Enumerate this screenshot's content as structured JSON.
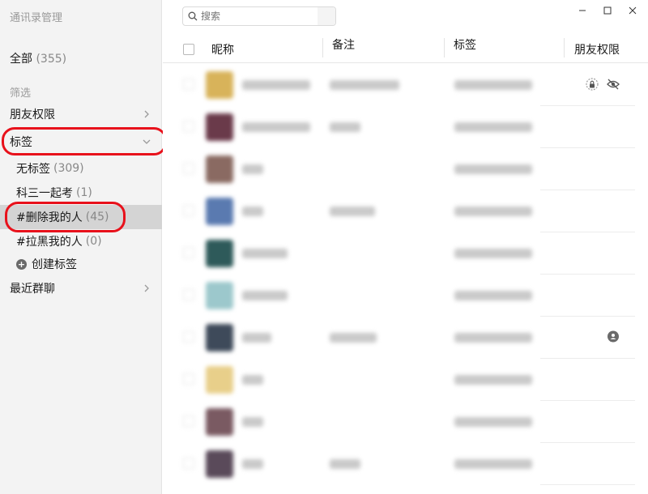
{
  "sidebar": {
    "title": "通讯录管理",
    "all_label": "全部",
    "all_count": "(355)",
    "filter_label": "筛选",
    "friend_permission_label": "朋友权限",
    "tags_label": "标签",
    "tags": [
      {
        "label": "无标签",
        "count": "(309)"
      },
      {
        "label": "科三一起考",
        "count": "(1)"
      },
      {
        "label": "#删除我的人",
        "count": "(45)"
      },
      {
        "label": "#拉黑我的人",
        "count": "(0)"
      }
    ],
    "create_tag_label": "创建标签",
    "recent_groups_label": "最近群聊"
  },
  "search": {
    "placeholder": "搜索"
  },
  "table": {
    "columns": [
      "昵称",
      "备注",
      "标签",
      "朋友权限"
    ],
    "rows": [
      {
        "avatar_color": "#d8b35a",
        "has_remark": true,
        "permission_icons": [
          "lock-icon",
          "eye-off-icon"
        ]
      },
      {
        "avatar_color": "#6a3a4a",
        "has_remark": true,
        "permission_icons": []
      },
      {
        "avatar_color": "#8a6a62",
        "has_remark": false,
        "permission_icons": []
      },
      {
        "avatar_color": "#5a7ab0",
        "has_remark": true,
        "permission_icons": []
      },
      {
        "avatar_color": "#2e5a5a",
        "has_remark": false,
        "permission_icons": []
      },
      {
        "avatar_color": "#9cc8cc",
        "has_remark": false,
        "permission_icons": []
      },
      {
        "avatar_color": "#3e4a5a",
        "has_remark": true,
        "permission_icons": [
          "chat-bubble-icon"
        ]
      },
      {
        "avatar_color": "#e8cf8a",
        "has_remark": false,
        "permission_icons": []
      },
      {
        "avatar_color": "#7a5a62",
        "has_remark": false,
        "permission_icons": []
      },
      {
        "avatar_color": "#5a4a5a",
        "has_remark": true,
        "permission_icons": []
      }
    ]
  },
  "colors": {
    "highlight_ring": "#e8111b",
    "sidebar_bg": "#f3f3f3",
    "selected_bg": "#d4d4d4"
  }
}
